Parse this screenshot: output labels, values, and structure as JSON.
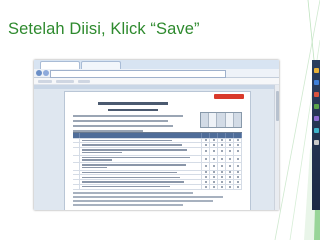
{
  "slide": {
    "title": "Setelah Diisi, Klick “Save”"
  },
  "browser": {
    "tabs": [
      "",
      ""
    ]
  },
  "colors": {
    "title": "#2e8a2e",
    "accent_lines": "#8fd18f",
    "save_button": "#d93a2b",
    "table_header": "#4f6d99"
  }
}
